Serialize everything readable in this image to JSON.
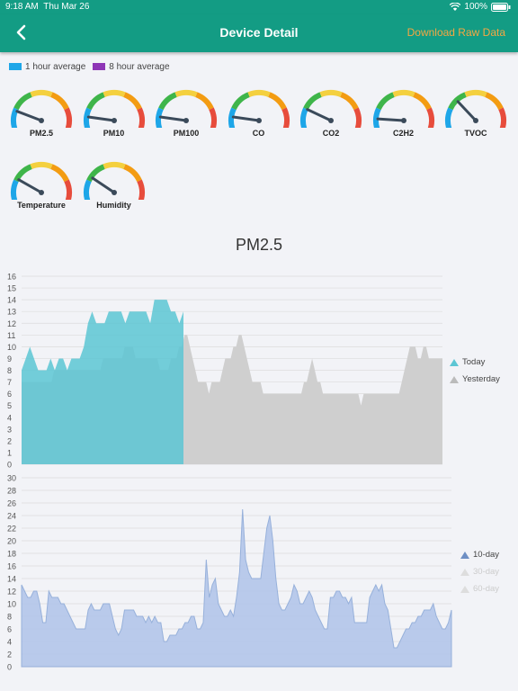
{
  "status_bar": {
    "time": "9:18 AM",
    "date": "Thu Mar 26",
    "battery": "100%"
  },
  "nav": {
    "title": "Device Detail",
    "action": "Download Raw Data",
    "back_icon": "chevron-left-icon"
  },
  "legend": [
    {
      "label": "1 hour average",
      "color": "#1ea6e8"
    },
    {
      "label": "8 hour average",
      "color": "#8e36b6"
    }
  ],
  "colors": {
    "header": "#139c84",
    "action": "#f5a742",
    "today": "#5cc6d4",
    "yesterday": "#cccccc",
    "ten_day": "#a9bfe5"
  },
  "gauges": [
    {
      "label": "PM2.5",
      "one_hour": 0.18,
      "eight_hour": 0.08
    },
    {
      "label": "PM10",
      "one_hour": 0.12,
      "eight_hour": 0.08
    },
    {
      "label": "PM100",
      "one_hour": 0.12,
      "eight_hour": 0.08
    },
    {
      "label": "CO",
      "one_hour": 0.12,
      "eight_hour": 0.08
    },
    {
      "label": "CO2",
      "one_hour": 0.2,
      "eight_hour": 0.08
    },
    {
      "label": "C2H2",
      "one_hour": 0.1,
      "eight_hour": 0.08
    },
    {
      "label": "TVOC",
      "one_hour": 0.3,
      "eight_hour": 0.08
    },
    {
      "label": "Temperature",
      "one_hour": 0.22,
      "eight_hour": 0.08
    },
    {
      "label": "Humidity",
      "one_hour": 0.24,
      "eight_hour": 0.08
    }
  ],
  "chart_data": [
    {
      "type": "area",
      "title": "PM2.5",
      "ylim": [
        0,
        16
      ],
      "yticks": [
        0,
        1,
        2,
        3,
        4,
        5,
        6,
        7,
        8,
        9,
        10,
        11,
        12,
        13,
        14,
        15,
        16
      ],
      "x_points": 48,
      "series": [
        {
          "name": "Today",
          "color": "#5cc6d4",
          "values": [
            8,
            9,
            10,
            9,
            8,
            8,
            8,
            9,
            8,
            9,
            9,
            8,
            9,
            9,
            9,
            10,
            12,
            13,
            12,
            12,
            12,
            13,
            13,
            13,
            13,
            12,
            13,
            13,
            13,
            13,
            13,
            12,
            14,
            14,
            14,
            14,
            13,
            13,
            12,
            13
          ]
        },
        {
          "name": "Yesterday",
          "color": "#cccccc",
          "values": [
            7,
            7,
            7,
            7,
            7,
            7,
            7,
            7,
            7,
            7,
            7,
            7,
            8,
            8,
            8,
            8,
            8,
            8,
            8,
            8,
            8,
            8,
            8,
            8,
            8,
            8,
            8,
            8,
            8,
            8,
            9,
            9,
            9,
            9,
            9,
            9,
            9,
            9,
            10,
            10,
            10,
            10,
            9,
            9,
            9,
            9,
            9,
            9,
            9,
            9,
            9,
            8,
            8,
            8,
            8,
            9,
            9,
            9,
            10,
            10,
            11,
            11,
            10,
            9,
            8,
            7,
            7,
            7,
            7,
            6,
            7,
            7,
            7,
            7,
            8,
            9,
            9,
            9,
            10,
            10,
            11,
            11,
            10,
            9,
            8,
            7,
            7,
            7,
            7,
            6,
            6,
            6,
            6,
            6,
            6,
            6,
            6,
            6,
            6,
            6,
            6,
            6,
            6,
            6,
            7,
            7,
            8,
            9,
            8,
            7,
            7,
            6,
            6,
            6,
            6,
            6,
            6,
            6,
            6,
            6,
            6,
            6,
            6,
            6,
            6,
            5,
            6,
            6,
            6,
            6,
            6,
            6,
            6,
            6,
            6,
            6,
            6,
            6,
            6,
            6,
            7,
            8,
            9,
            10,
            10,
            10,
            9,
            9,
            10,
            10,
            9,
            9,
            9,
            9,
            9,
            9
          ]
        }
      ]
    },
    {
      "type": "area",
      "title": "",
      "ylim": [
        0,
        30
      ],
      "yticks": [
        0,
        2,
        4,
        6,
        8,
        10,
        12,
        14,
        16,
        18,
        20,
        22,
        24,
        26,
        28,
        30
      ],
      "series": [
        {
          "name": "10-day",
          "color": "#a9bfe5",
          "values": [
            13,
            12,
            11,
            11,
            12,
            12,
            10,
            7,
            7,
            12,
            11,
            11,
            11,
            10,
            10,
            9,
            8,
            7,
            6,
            6,
            6,
            6,
            9,
            10,
            9,
            9,
            9,
            10,
            10,
            10,
            8,
            6,
            5,
            6,
            9,
            9,
            9,
            9,
            8,
            8,
            8,
            7,
            8,
            7,
            8,
            7,
            7,
            4,
            4,
            5,
            5,
            5,
            6,
            6,
            7,
            7,
            8,
            8,
            6,
            6,
            7,
            17,
            11,
            13,
            14,
            10,
            9,
            8,
            8,
            9,
            8,
            11,
            15,
            25,
            17,
            15,
            14,
            14,
            14,
            14,
            18,
            22,
            24,
            20,
            14,
            10,
            9,
            9,
            10,
            11,
            13,
            12,
            10,
            10,
            11,
            12,
            11,
            9,
            8,
            7,
            6,
            6,
            11,
            11,
            12,
            12,
            11,
            11,
            10,
            11,
            7,
            7,
            7,
            7,
            7,
            11,
            12,
            13,
            12,
            13,
            10,
            9,
            6,
            3,
            3,
            4,
            5,
            6,
            6,
            7,
            7,
            8,
            8,
            9,
            9,
            9,
            10,
            8,
            7,
            6,
            6,
            7,
            9
          ]
        },
        {
          "name": "30-day",
          "color": "#dddddd",
          "values": []
        },
        {
          "name": "60-day",
          "color": "#dddddd",
          "values": []
        }
      ]
    }
  ]
}
